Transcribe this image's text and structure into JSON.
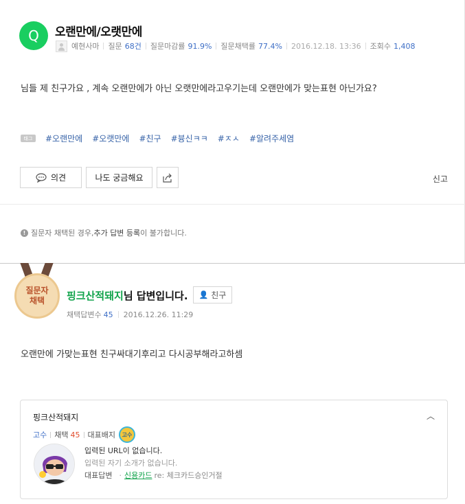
{
  "question": {
    "badge": "Q",
    "title": "오랜만에/오랫만에",
    "author": "예현사마",
    "meta": {
      "questions_label": "질문",
      "questions_value": "68건",
      "deadline_label": "질문마감률",
      "deadline_value": "91.9%",
      "adopt_label": "질문채택률",
      "adopt_value": "77.4%",
      "date": "2016.12.18. 13:36",
      "views_label": "조회수",
      "views_value": "1,408"
    },
    "body": "님들 제 친구가요 , 계속 오랜만에가 아닌 오랫만에라고우기는데 오랜만에가 맞는표현 아닌가요?",
    "tag_icon": "태그",
    "tags": [
      "#오랜만에",
      "#오랫만에",
      "#친구",
      "#븅신ㅋㅋ",
      "#ㅈㅅ",
      "#알려주세염"
    ],
    "buttons": {
      "opinion": "의견",
      "curious": "나도 궁금해요",
      "report": "신고"
    },
    "notice_icon": "!",
    "notice_pre": "질문자 채택된 경우, ",
    "notice_bold": "추가 답변 등록",
    "notice_post": "이 불가합니다."
  },
  "answer": {
    "medal_line1": "질문자",
    "medal_line2": "채택",
    "name": "핑크산적돼지",
    "title_suffix": "님 답변입니다.",
    "friend_button": "친구",
    "adopt_count_label": "채택답변수",
    "adopt_count_value": "45",
    "date": "2016.12.26. 11:29",
    "body": "오랜만에 가맞는표현 친구싸대기후리고 다시공부해라고하셈"
  },
  "profile": {
    "name": "핑크산적돼지",
    "grade": "고수",
    "adopt_label": "채택",
    "adopt_value": "45",
    "badge_label": "대표배지",
    "badge_icon_text": "고수",
    "url_text": "입력된 URL이 없습니다.",
    "intro_text": "입력된 자기 소개가 없습니다.",
    "rep_answer_label": "대표답변",
    "rep_answer_link": "신용카드",
    "rep_answer_rest": "re: 체크카드승인거절"
  },
  "colors": {
    "green": "#19ce60",
    "link_blue": "#3763a8",
    "highlight_red": "#e14c2c"
  }
}
